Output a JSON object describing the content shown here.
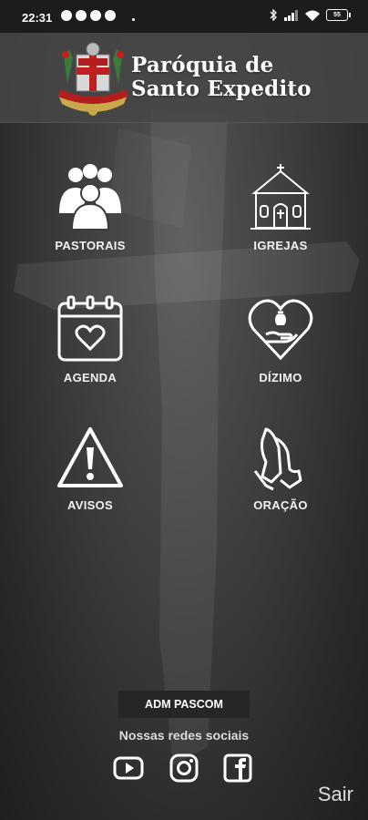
{
  "status": {
    "time": "22:31",
    "battery": "55"
  },
  "header": {
    "title_line1": "Paróquia de",
    "title_line2": "Santo Expedito"
  },
  "menu": [
    {
      "label": "PASTORAIS",
      "icon": "people-group-icon"
    },
    {
      "label": "IGREJAS",
      "icon": "church-icon"
    },
    {
      "label": "AGENDA",
      "icon": "calendar-heart-icon"
    },
    {
      "label": "DÍZIMO",
      "icon": "heart-donation-icon"
    },
    {
      "label": "AVISOS",
      "icon": "warning-icon"
    },
    {
      "label": "ORAÇÃO",
      "icon": "praying-hands-icon"
    }
  ],
  "footer": {
    "admin_button": "ADM PASCOM",
    "social_title": "Nossas redes sociais",
    "social": [
      "youtube-icon",
      "instagram-icon",
      "facebook-icon"
    ],
    "logout": "Sair"
  },
  "colors": {
    "background": "#3c3c3c",
    "header": "#464646",
    "text": "#ffffff"
  }
}
